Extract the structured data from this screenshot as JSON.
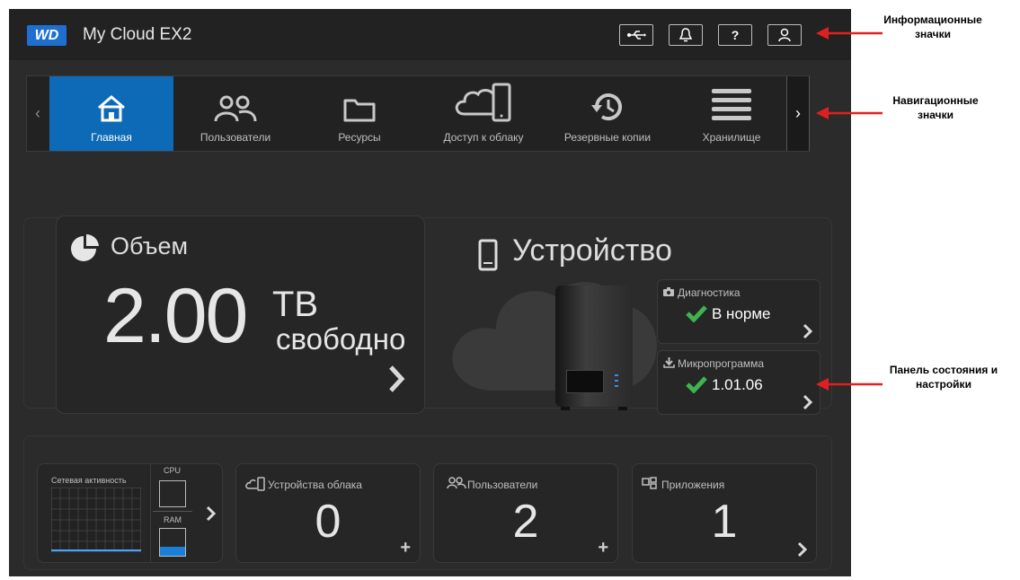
{
  "header": {
    "logo_text": "WD",
    "app_title": "My Cloud EX2",
    "icons": [
      "usb-icon",
      "bell-icon",
      "help-icon",
      "user-icon"
    ]
  },
  "nav": {
    "items": [
      {
        "label": "Главная",
        "icon": "home-icon",
        "active": true
      },
      {
        "label": "Пользователи",
        "icon": "users-icon",
        "active": false
      },
      {
        "label": "Ресурсы",
        "icon": "folder-icon",
        "active": false
      },
      {
        "label": "Доступ к облаку",
        "icon": "cloud-devices-icon",
        "active": false
      },
      {
        "label": "Резервные копии",
        "icon": "backup-icon",
        "active": false
      },
      {
        "label": "Хранилище",
        "icon": "storage-icon",
        "active": false
      }
    ],
    "left_arrow": "‹",
    "right_arrow": "›"
  },
  "capacity": {
    "title": "Объем",
    "value": "2.00",
    "unit": "TB",
    "suffix": "свободно"
  },
  "device": {
    "title": "Устройство",
    "diagnostics_label": "Диагностика",
    "diagnostics_value": "В норме",
    "firmware_label": "Микропрограмма",
    "firmware_value": "1.01.06"
  },
  "widgets": {
    "network_label": "Сетевая активность",
    "cpu_label": "CPU",
    "ram_label": "RAM",
    "cloud_devices_label": "Устройства облака",
    "cloud_devices_value": "0",
    "users_label": "Пользователи",
    "users_value": "2",
    "apps_label": "Приложения",
    "apps_value": "1"
  },
  "annotations": {
    "info": "Информационные значки",
    "nav": "Навигационные значки",
    "status": "Панель состояния и настройки"
  },
  "colors": {
    "accent": "#0d6ab7",
    "check": "#3fb34f",
    "annotation_arrow": "#e02020"
  }
}
